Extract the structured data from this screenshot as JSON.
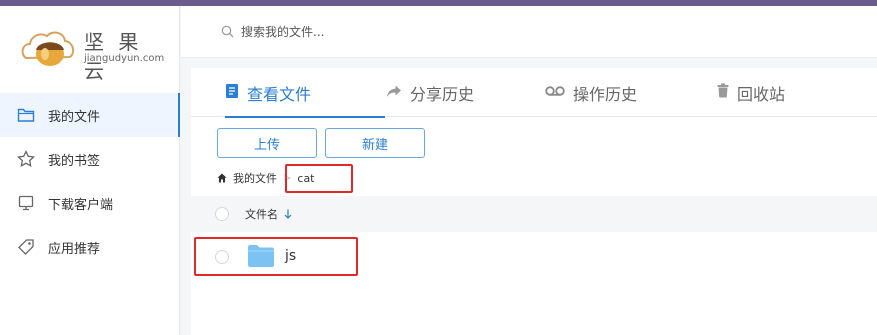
{
  "colors": {
    "topbar": "#6b5b8c",
    "accent": "#2a7fd4",
    "highlight": "#e02a2a",
    "folder": "#7cc2f2"
  },
  "logo": {
    "name_cn": "坚 果 云",
    "domain": "jiangudyun.com"
  },
  "search": {
    "placeholder": "搜索我的文件..."
  },
  "sidebar": {
    "items": [
      {
        "label": "我的文件",
        "icon": "folder-outline-icon",
        "active": true
      },
      {
        "label": "我的书签",
        "icon": "star-icon",
        "active": false
      },
      {
        "label": "下载客户端",
        "icon": "monitor-icon",
        "active": false
      },
      {
        "label": "应用推荐",
        "icon": "tag-icon",
        "active": false
      }
    ]
  },
  "tabs": [
    {
      "label": "查看文件",
      "icon": "document-icon",
      "active": true
    },
    {
      "label": "分享历史",
      "icon": "share-arrow-icon",
      "active": false
    },
    {
      "label": "操作历史",
      "icon": "cassette-icon",
      "active": false
    },
    {
      "label": "回收站",
      "icon": "trash-icon",
      "active": false
    }
  ],
  "toolbar": {
    "upload_label": "上传",
    "new_label": "新建"
  },
  "breadcrumb": {
    "root": "我的文件",
    "separator": ">",
    "current": "cat"
  },
  "table": {
    "header_name": "文件名",
    "sort_icon": "arrow-down-icon",
    "rows": [
      {
        "name": "js",
        "type": "folder"
      }
    ]
  }
}
